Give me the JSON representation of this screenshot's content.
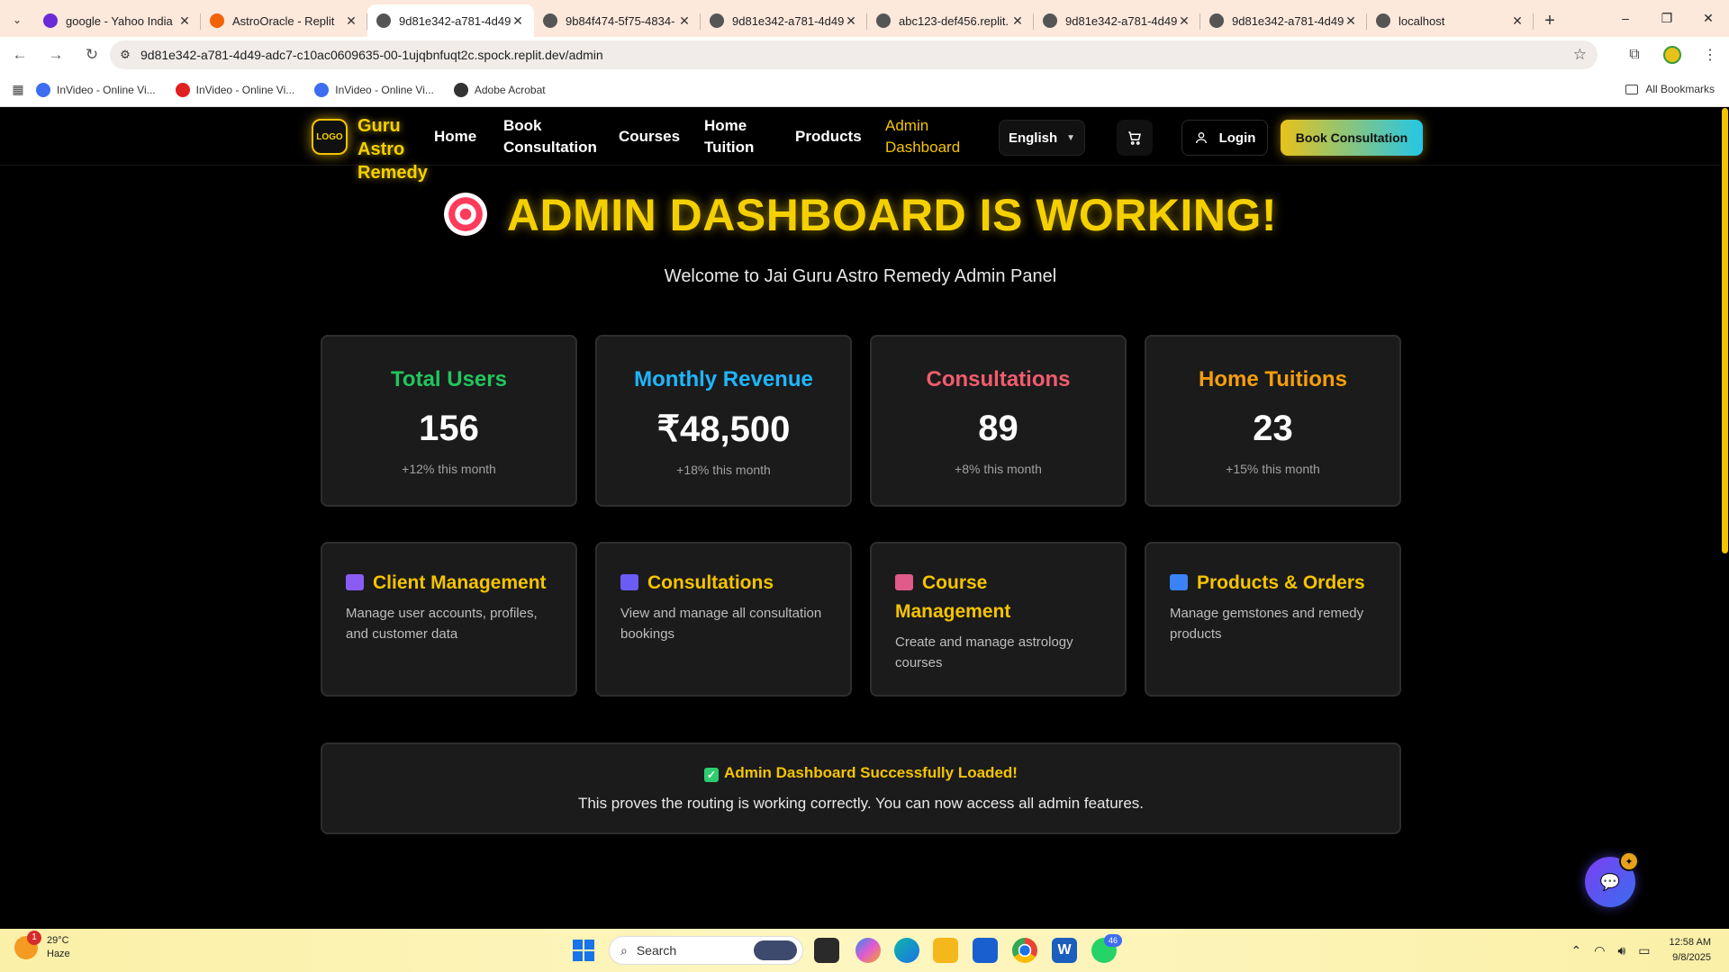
{
  "browser": {
    "tabs": [
      {
        "title": "google - Yahoo India",
        "fav_color": "#6a2ad8",
        "active": false
      },
      {
        "title": "AstroOracle - Replit",
        "fav_color": "#f26207",
        "active": false
      },
      {
        "title": "9d81e342-a781-4d49",
        "fav_color": "#555555",
        "active": true
      },
      {
        "title": "9b84f474-5f75-4834-",
        "fav_color": "#555555",
        "active": false
      },
      {
        "title": "9d81e342-a781-4d49",
        "fav_color": "#555555",
        "active": false
      },
      {
        "title": "abc123-def456.replit.",
        "fav_color": "#555555",
        "active": false
      },
      {
        "title": "9d81e342-a781-4d49",
        "fav_color": "#555555",
        "active": false
      },
      {
        "title": "9d81e342-a781-4d49",
        "fav_color": "#555555",
        "active": false
      },
      {
        "title": "localhost",
        "fav_color": "#555555",
        "active": false
      }
    ],
    "url": "9d81e342-a781-4d49-adc7-c10ac0609635-00-1ujqbnfuqt2c.spock.replit.dev/admin",
    "bookmarks": [
      {
        "label": "InVideo - Online Vi...",
        "color": "#3d6df0"
      },
      {
        "label": "InVideo - Online Vi...",
        "color": "#e02020"
      },
      {
        "label": "InVideo - Online Vi...",
        "color": "#3d6df0"
      },
      {
        "label": "Adobe Acrobat",
        "color": "#333333"
      }
    ],
    "all_bookmarks": "All Bookmarks"
  },
  "site": {
    "logo_text": "LOGO",
    "brand": "Guru Astro Remedy",
    "nav": {
      "home": "Home",
      "book_consultation": "Book Consultation",
      "courses": "Courses",
      "home_tuition": "Home Tuition",
      "products": "Products",
      "admin_dashboard": "Admin Dashboard"
    },
    "language": "English",
    "login": "Login",
    "cta": "Book Consultation",
    "accent": "#f5c400"
  },
  "hero": {
    "title": "ADMIN DASHBOARD IS WORKING!",
    "subtitle": "Welcome to Jai Guru Astro Remedy Admin Panel"
  },
  "stats": [
    {
      "label": "Total Users",
      "value": "156",
      "delta": "+12% this month",
      "color": "#22c55e"
    },
    {
      "label": "Monthly Revenue",
      "value": "₹48,500",
      "delta": "+18% this month",
      "color": "#1fb6ff"
    },
    {
      "label": "Consultations",
      "value": "89",
      "delta": "+8% this month",
      "color": "#f25c6e"
    },
    {
      "label": "Home Tuitions",
      "value": "23",
      "delta": "+15% this month",
      "color": "#f59e0b"
    }
  ],
  "features": [
    {
      "title": "Client Management",
      "desc": "Manage user accounts, profiles, and customer data",
      "icon": "people-icon",
      "icon_color": "#8a5cf6"
    },
    {
      "title": "Consultations",
      "desc": "View and manage all consultation bookings",
      "icon": "calculator-icon",
      "icon_color": "#6b5cf6"
    },
    {
      "title": "Course Management",
      "desc": "Create and manage astrology courses",
      "icon": "books-icon",
      "icon_color": "#e05a8a"
    },
    {
      "title": "Products & Orders",
      "desc": "Manage gemstones and remedy products",
      "icon": "shopping-bags-icon",
      "icon_color": "#3b82f6"
    }
  ],
  "success": {
    "title": "Admin Dashboard Successfully Loaded!",
    "desc": "This proves the routing is working correctly. You can now access all admin features."
  },
  "taskbar": {
    "weather_temp": "29°C",
    "weather_desc": "Haze",
    "weather_badge": "1",
    "search": "Search",
    "whatsapp_badge": "46",
    "time": "12:58 AM",
    "date": "9/8/2025"
  }
}
